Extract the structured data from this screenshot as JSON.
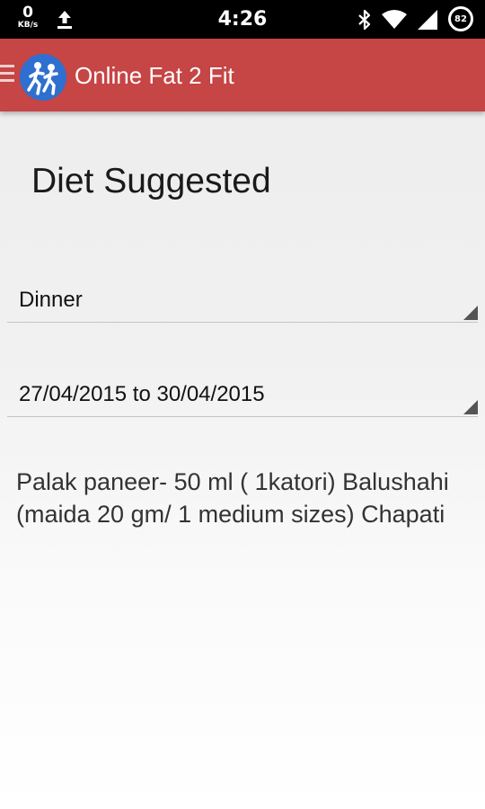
{
  "status_bar": {
    "net_speed_value": "0",
    "net_speed_unit": "KB/s",
    "time": "4:26",
    "battery_level": "82",
    "icons": [
      "upload-icon",
      "bluetooth-icon",
      "wifi-icon",
      "signal-icon",
      "battery-icon"
    ]
  },
  "action_bar": {
    "title": "Online Fat 2 Fit",
    "background_color": "#c64545",
    "icons": [
      "drawer-icon",
      "app-logo-icon"
    ]
  },
  "page": {
    "title": "Diet Suggested"
  },
  "meal_select": {
    "selected": "Dinner"
  },
  "date_range_select": {
    "selected": "27/04/2015 to 30/04/2015"
  },
  "diet": {
    "text": "Palak paneer- 50 ml ( 1katori) Balushahi (maida 20 gm/ 1 medium sizes) Chapati"
  }
}
